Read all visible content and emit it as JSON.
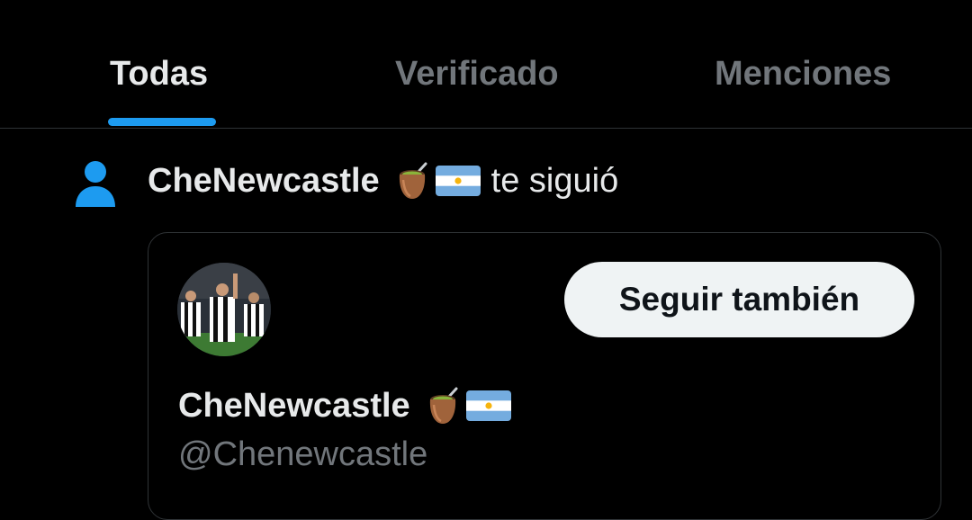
{
  "tabs": [
    {
      "label": "Todas",
      "active": true
    },
    {
      "label": "Verificado",
      "active": false
    },
    {
      "label": "Menciones",
      "active": false
    }
  ],
  "colors": {
    "accent": "#1d9bf0",
    "background": "#000000",
    "text_primary": "#e7e9ea",
    "text_secondary": "#71767b",
    "button_bg": "#eff3f4"
  },
  "notification": {
    "icon": "person-icon",
    "user_name": "CheNewcastle",
    "emojis": [
      "mate-icon",
      "argentina-flag-icon"
    ],
    "action": "te siguió"
  },
  "profile_card": {
    "avatar": "profile-avatar",
    "display_name": "CheNewcastle",
    "emojis": [
      "mate-icon",
      "argentina-flag-icon"
    ],
    "handle": "@Chenewcastle",
    "follow_button_label": "Seguir también"
  }
}
